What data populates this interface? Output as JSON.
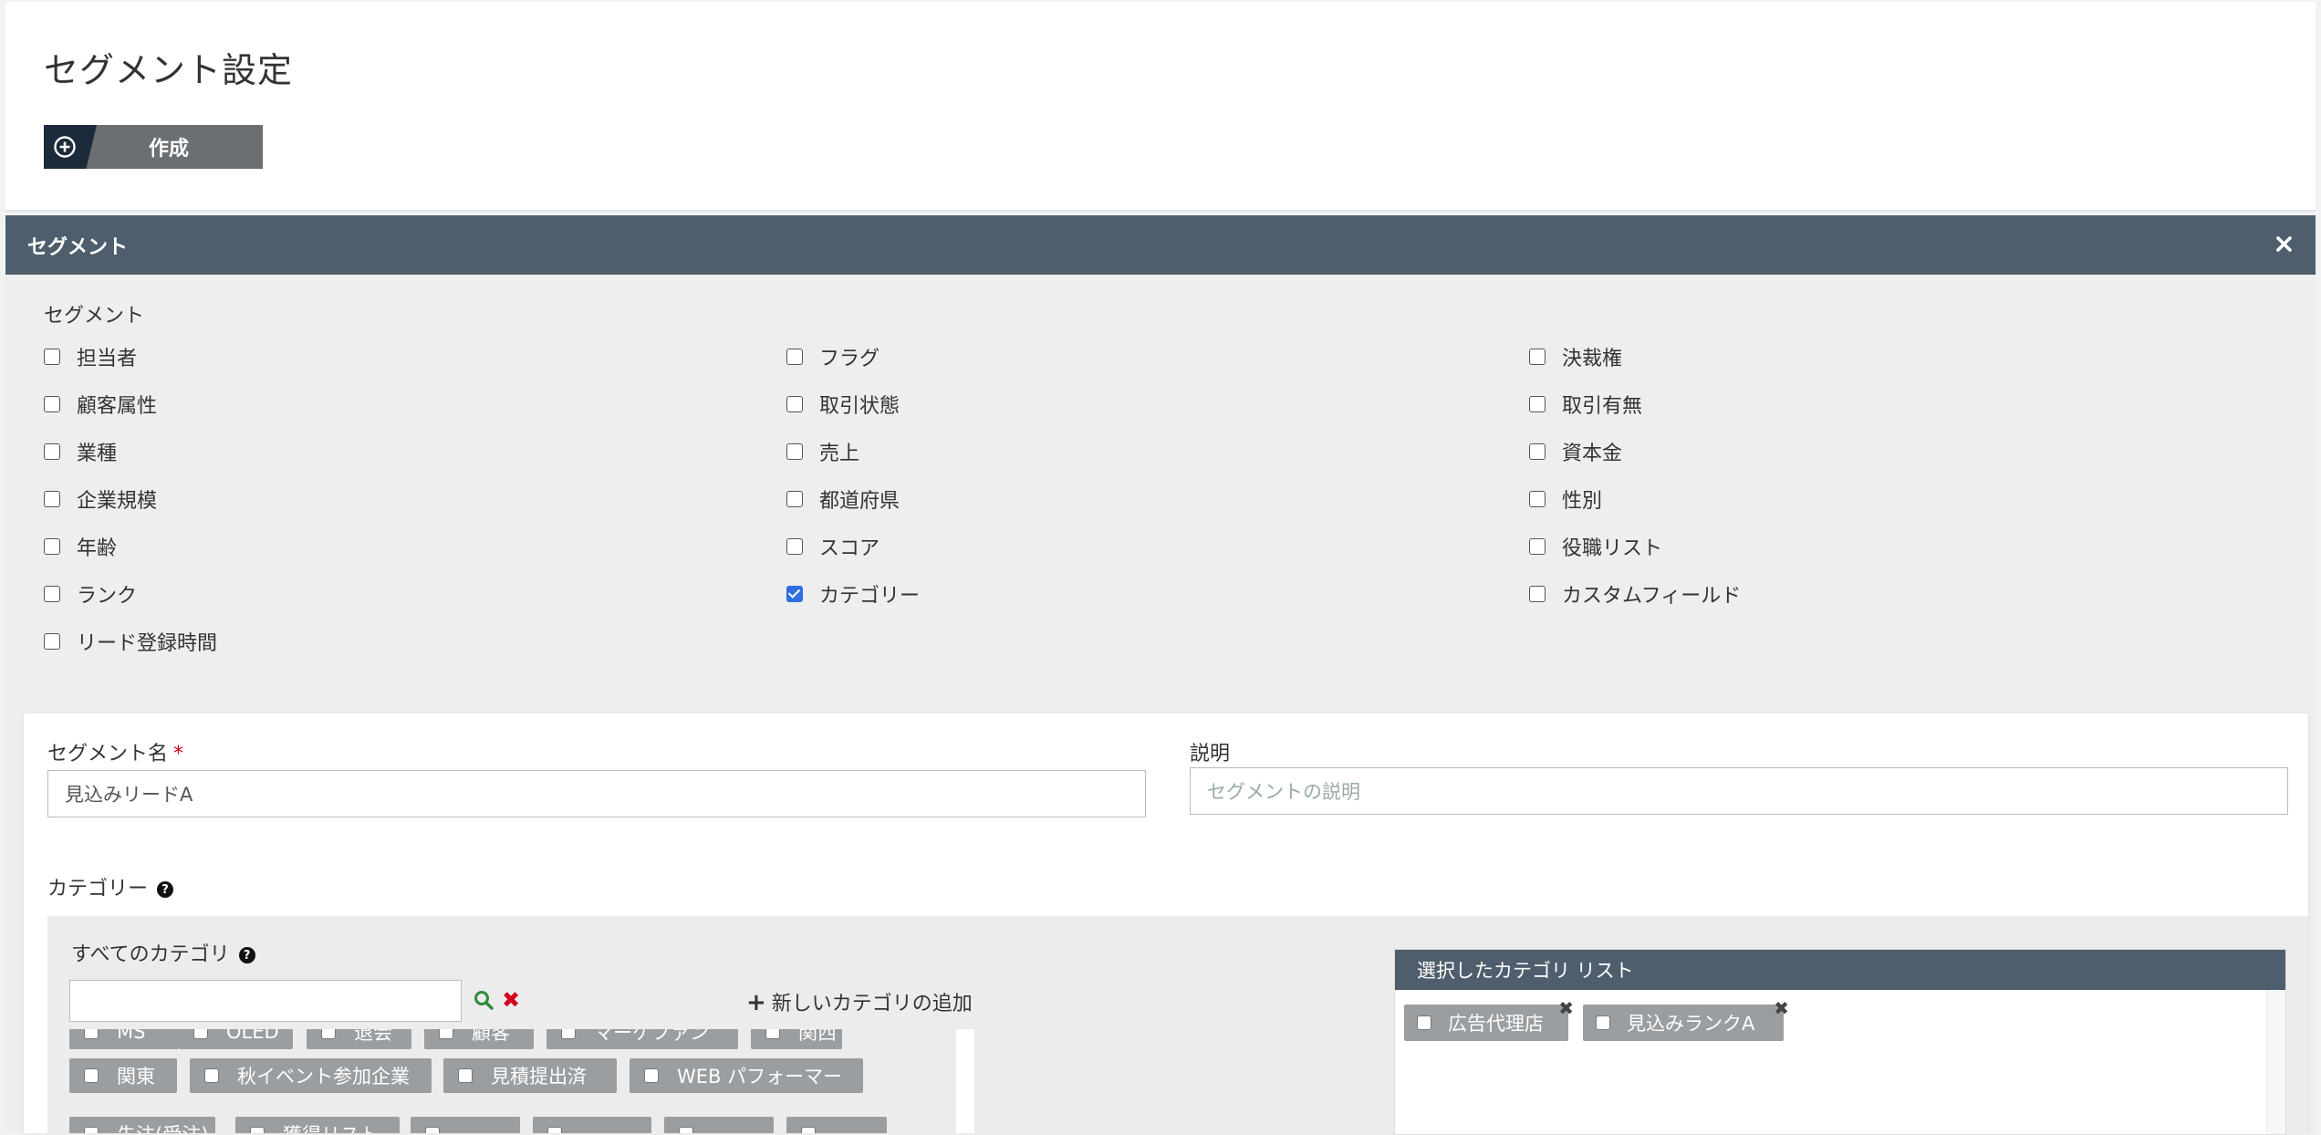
{
  "page": {
    "title": "セグメント設定",
    "create_label": "作成"
  },
  "segment_panel": {
    "header": "セグメント",
    "close": "×",
    "subtitle": "セグメント",
    "options": [
      {
        "label": "担当者",
        "checked": false
      },
      {
        "label": "フラグ",
        "checked": false
      },
      {
        "label": "決裁権",
        "checked": false
      },
      {
        "label": "顧客属性",
        "checked": false
      },
      {
        "label": "取引状態",
        "checked": false
      },
      {
        "label": "取引有無",
        "checked": false
      },
      {
        "label": "業種",
        "checked": false
      },
      {
        "label": "売上",
        "checked": false
      },
      {
        "label": "資本金",
        "checked": false
      },
      {
        "label": "企業規模",
        "checked": false
      },
      {
        "label": "都道府県",
        "checked": false
      },
      {
        "label": "性別",
        "checked": false
      },
      {
        "label": "年齢",
        "checked": false
      },
      {
        "label": "スコア",
        "checked": false
      },
      {
        "label": "役職リスト",
        "checked": false
      },
      {
        "label": "ランク",
        "checked": false
      },
      {
        "label": "カテゴリー",
        "checked": true
      },
      {
        "label": "カスタムフィールド",
        "checked": false
      },
      {
        "label": "リード登録時間",
        "checked": false
      }
    ]
  },
  "form": {
    "name_label": "セグメント名",
    "required_mark": "*",
    "name_value": "見込みリードA",
    "desc_label": "説明",
    "desc_placeholder": "セグメントの説明",
    "category_label": "カテゴリー",
    "help_glyph": "?",
    "all_categories_label": "すべてのカテゴリ",
    "add_category_label": "新しいカテゴリの追加",
    "add_glyph": "+",
    "clear_glyph": "✖",
    "chips": [
      "MS",
      "OLED",
      "退会",
      "顧客",
      "マーケファン",
      "関西",
      "関東",
      "秋イベント参加企業",
      "見積提出済",
      "WEB パフォーマー",
      "先注(受注)",
      "獲得リスト",
      "",
      "",
      "",
      ""
    ],
    "selected_header": "選択したカテゴリ リスト",
    "selected": [
      "広告代理店",
      "見込みランクA"
    ],
    "remove_glyph": "✖"
  },
  "colors": {
    "header_bg": "#4f5e6c",
    "chip_bg": "#9a9ea1",
    "accent": "#2f6ee2",
    "required": "#d0021b"
  }
}
